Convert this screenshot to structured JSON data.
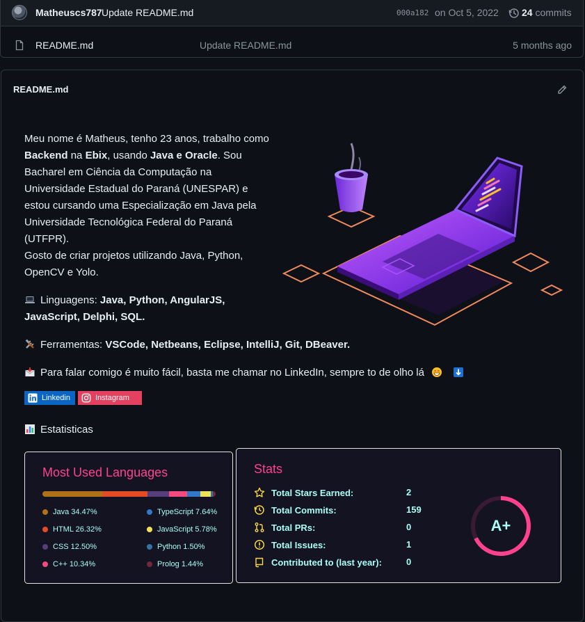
{
  "commit": {
    "author": "Matheuscs787",
    "message": "Update README.md",
    "sha": "000a182",
    "date": "on Oct 5, 2022",
    "count": "24",
    "count_label": "commits"
  },
  "file": {
    "name": "README.md",
    "message": "Update README.md",
    "age": "5 months ago"
  },
  "readme": {
    "title": "README.md",
    "intro": {
      "t1": "Meu nome é Matheus, tenho 23 anos, trabalho como ",
      "b1": "Backend",
      "t2": " na ",
      "b2": "Ebix",
      "t3": ", usando ",
      "b3": "Java e Oracle",
      "t4": ". Sou Bacharel em Ciência da Computação na Universidade Estadual do Paraná (UNESPAR) e estou cursando uma Especialização em Java pela Universidade Tecnológica Federal do Paraná (UTFPR).",
      "t5": "Gosto de criar projetos utilizando Java, Python, OpenCV e Yolo."
    },
    "languages_label": "Linguagens: ",
    "languages_list": "Java, Python, AngularJS, JavaScript, Delphi, SQL.",
    "tools_label": "Ferramentas: ",
    "tools_list": "VSCode, Netbeans, Eclipse, IntelliJ, Git, DBeaver.",
    "contact": "Para falar comigo é muito fácil, basta me chamar no LinkedIn, sempre to de olho lá",
    "badges": [
      "Linkedin",
      "Instagram"
    ],
    "stats_heading": "Estatisticas",
    "emoji_icons": [
      "laptop-icon",
      "tools-icon",
      "envelope-icon",
      "grin-icon",
      "point-down-icon",
      "bar-chart-icon"
    ]
  },
  "languages_card": {
    "title": "Most Used Languages",
    "items": [
      {
        "name": "Java",
        "percent": 34.47,
        "label": "Java 34.47%",
        "color": "#b07219"
      },
      {
        "name": "HTML",
        "percent": 26.32,
        "label": "HTML 26.32%",
        "color": "#e34c26"
      },
      {
        "name": "CSS",
        "percent": 12.5,
        "label": "CSS 12.50%",
        "color": "#563d7c"
      },
      {
        "name": "C++",
        "percent": 10.34,
        "label": "C++ 10.34%",
        "color": "#f34b7d"
      },
      {
        "name": "TypeScript",
        "percent": 7.64,
        "label": "TypeScript 7.64%",
        "color": "#3178c6"
      },
      {
        "name": "JavaScript",
        "percent": 5.78,
        "label": "JavaScript 5.78%",
        "color": "#f1e05a"
      },
      {
        "name": "Python",
        "percent": 1.5,
        "label": "Python 1.50%",
        "color": "#3572a5"
      },
      {
        "name": "Prolog",
        "percent": 1.44,
        "label": "Prolog 1.44%",
        "color": "#74283c"
      }
    ]
  },
  "stats_card": {
    "title": "Stats",
    "rows": [
      {
        "label": "Total Stars Earned:",
        "value": "2",
        "icon": "star-icon"
      },
      {
        "label": "Total Commits:",
        "value": "159",
        "icon": "history-icon"
      },
      {
        "label": "Total PRs:",
        "value": "0",
        "icon": "pull-request-icon"
      },
      {
        "label": "Total Issues:",
        "value": "1",
        "icon": "issue-icon"
      },
      {
        "label": "Contributed to (last year):",
        "value": "0",
        "icon": "repo-icon"
      }
    ],
    "grade": "A+"
  },
  "colors": {
    "accent_title": "#fe428e",
    "stat_text": "#a9fef7",
    "card_bg": "#141321",
    "page_bg": "#0d1117"
  }
}
